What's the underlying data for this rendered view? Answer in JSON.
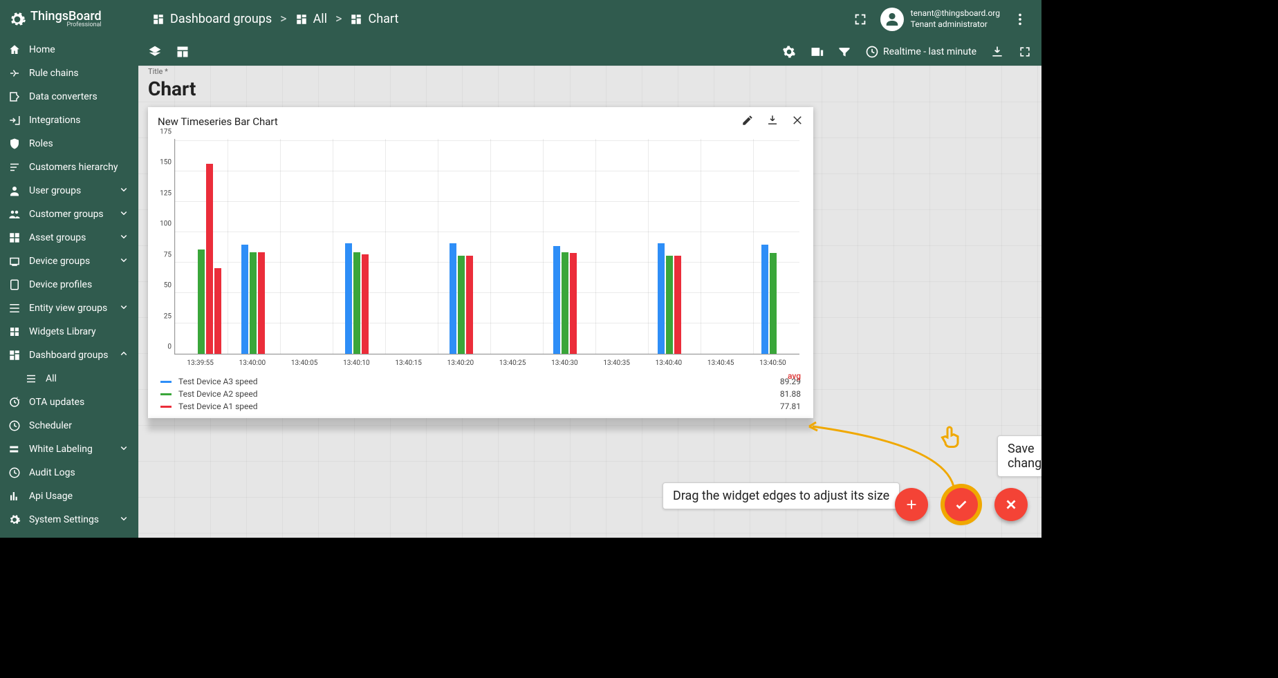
{
  "brand": {
    "name": "ThingsBoard",
    "edition": "Professional"
  },
  "breadcrumbs": [
    {
      "label": "Dashboard groups"
    },
    {
      "label": "All"
    },
    {
      "label": "Chart"
    }
  ],
  "user": {
    "email": "tenant@thingsboard.org",
    "role": "Tenant administrator"
  },
  "sidebar": {
    "items": [
      {
        "icon": "home",
        "label": "Home"
      },
      {
        "icon": "rules",
        "label": "Rule chains"
      },
      {
        "icon": "converters",
        "label": "Data converters"
      },
      {
        "icon": "integrations",
        "label": "Integrations"
      },
      {
        "icon": "shield",
        "label": "Roles"
      },
      {
        "icon": "hierarchy",
        "label": "Customers hierarchy"
      },
      {
        "icon": "person",
        "label": "User groups",
        "expandable": true,
        "expanded": false
      },
      {
        "icon": "people",
        "label": "Customer groups",
        "expandable": true,
        "expanded": false
      },
      {
        "icon": "domain",
        "label": "Asset groups",
        "expandable": true,
        "expanded": false
      },
      {
        "icon": "devices",
        "label": "Device groups",
        "expandable": true,
        "expanded": false
      },
      {
        "icon": "profile",
        "label": "Device profiles"
      },
      {
        "icon": "entity",
        "label": "Entity view groups",
        "expandable": true,
        "expanded": false
      },
      {
        "icon": "widgets",
        "label": "Widgets Library"
      },
      {
        "icon": "dashboard",
        "label": "Dashboard groups",
        "expandable": true,
        "expanded": true
      },
      {
        "icon": "list",
        "label": "All",
        "child": true
      },
      {
        "icon": "ota",
        "label": "OTA updates"
      },
      {
        "icon": "clock",
        "label": "Scheduler"
      },
      {
        "icon": "label",
        "label": "White Labeling",
        "expandable": true,
        "expanded": false
      },
      {
        "icon": "audit",
        "label": "Audit Logs"
      },
      {
        "icon": "usage",
        "label": "Api Usage"
      },
      {
        "icon": "gear",
        "label": "System Settings",
        "expandable": true,
        "expanded": false
      }
    ]
  },
  "toolbar": {
    "time": "Realtime - last minute"
  },
  "page": {
    "title_label": "Title *",
    "title": "Chart"
  },
  "widget": {
    "title": "New Timeseries Bar Chart",
    "legend_avg_header": "avg",
    "series": [
      {
        "name": "Test Device A3 speed",
        "color": "#2e8ef7",
        "avg": "89.29"
      },
      {
        "name": "Test Device A2 speed",
        "color": "#3aa63a",
        "avg": "81.88"
      },
      {
        "name": "Test Device A1 speed",
        "color": "#eb2d3a",
        "avg": "77.81"
      }
    ]
  },
  "chart_data": {
    "type": "bar",
    "title": "New Timeseries Bar Chart",
    "xlabel": "",
    "ylabel": "",
    "ylim": [
      0,
      175
    ],
    "yticks": [
      0,
      25,
      50,
      75,
      100,
      125,
      150,
      175
    ],
    "xticks": [
      "13:39:55",
      "13:40:00",
      "13:40:05",
      "13:40:10",
      "13:40:15",
      "13:40:20",
      "13:40:25",
      "13:40:30",
      "13:40:35",
      "13:40:40",
      "13:40:45",
      "13:40:50"
    ],
    "series": [
      {
        "name": "Test Device A3 speed",
        "color": "#2e8ef7",
        "values": [
          null,
          89,
          null,
          90,
          null,
          90,
          null,
          88,
          null,
          90,
          null,
          89
        ]
      },
      {
        "name": "Test Device A2 speed",
        "color": "#3aa63a",
        "values": [
          85,
          83,
          null,
          83,
          null,
          80,
          null,
          83,
          null,
          80,
          null,
          82
        ]
      },
      {
        "name": "Test Device A1 speed",
        "color": "#eb2d3a",
        "values": [
          155,
          83,
          null,
          81,
          null,
          80,
          null,
          82,
          null,
          80,
          null,
          null
        ],
        "second_bar_at_0": 70
      }
    ]
  },
  "annotations": {
    "drag": "Drag the widget edges to adjust its size",
    "save": "Save changes"
  }
}
